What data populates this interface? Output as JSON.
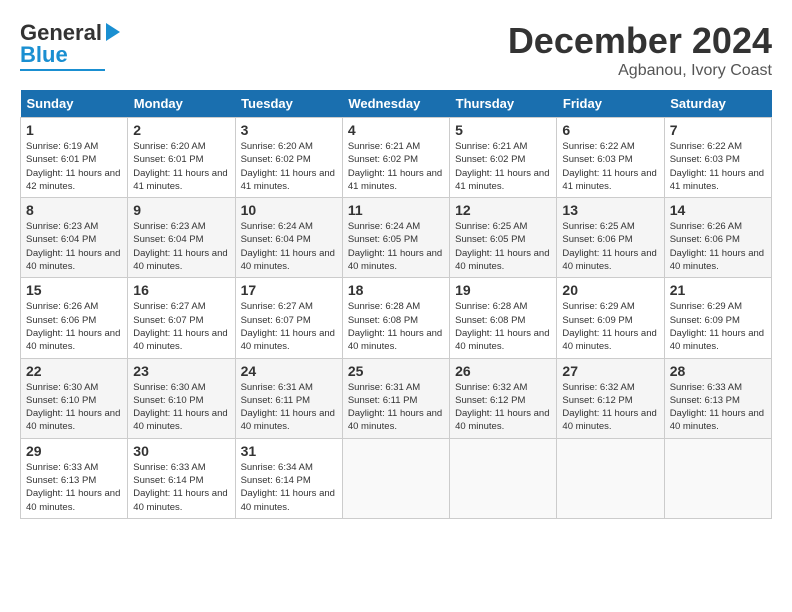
{
  "header": {
    "logo_line1": "General",
    "logo_line2": "Blue",
    "month": "December 2024",
    "location": "Agbanou, Ivory Coast"
  },
  "days_of_week": [
    "Sunday",
    "Monday",
    "Tuesday",
    "Wednesday",
    "Thursday",
    "Friday",
    "Saturday"
  ],
  "weeks": [
    [
      {
        "day": "1",
        "info": "Sunrise: 6:19 AM\nSunset: 6:01 PM\nDaylight: 11 hours and 42 minutes."
      },
      {
        "day": "2",
        "info": "Sunrise: 6:20 AM\nSunset: 6:01 PM\nDaylight: 11 hours and 41 minutes."
      },
      {
        "day": "3",
        "info": "Sunrise: 6:20 AM\nSunset: 6:02 PM\nDaylight: 11 hours and 41 minutes."
      },
      {
        "day": "4",
        "info": "Sunrise: 6:21 AM\nSunset: 6:02 PM\nDaylight: 11 hours and 41 minutes."
      },
      {
        "day": "5",
        "info": "Sunrise: 6:21 AM\nSunset: 6:02 PM\nDaylight: 11 hours and 41 minutes."
      },
      {
        "day": "6",
        "info": "Sunrise: 6:22 AM\nSunset: 6:03 PM\nDaylight: 11 hours and 41 minutes."
      },
      {
        "day": "7",
        "info": "Sunrise: 6:22 AM\nSunset: 6:03 PM\nDaylight: 11 hours and 41 minutes."
      }
    ],
    [
      {
        "day": "8",
        "info": "Sunrise: 6:23 AM\nSunset: 6:04 PM\nDaylight: 11 hours and 40 minutes."
      },
      {
        "day": "9",
        "info": "Sunrise: 6:23 AM\nSunset: 6:04 PM\nDaylight: 11 hours and 40 minutes."
      },
      {
        "day": "10",
        "info": "Sunrise: 6:24 AM\nSunset: 6:04 PM\nDaylight: 11 hours and 40 minutes."
      },
      {
        "day": "11",
        "info": "Sunrise: 6:24 AM\nSunset: 6:05 PM\nDaylight: 11 hours and 40 minutes."
      },
      {
        "day": "12",
        "info": "Sunrise: 6:25 AM\nSunset: 6:05 PM\nDaylight: 11 hours and 40 minutes."
      },
      {
        "day": "13",
        "info": "Sunrise: 6:25 AM\nSunset: 6:06 PM\nDaylight: 11 hours and 40 minutes."
      },
      {
        "day": "14",
        "info": "Sunrise: 6:26 AM\nSunset: 6:06 PM\nDaylight: 11 hours and 40 minutes."
      }
    ],
    [
      {
        "day": "15",
        "info": "Sunrise: 6:26 AM\nSunset: 6:06 PM\nDaylight: 11 hours and 40 minutes."
      },
      {
        "day": "16",
        "info": "Sunrise: 6:27 AM\nSunset: 6:07 PM\nDaylight: 11 hours and 40 minutes."
      },
      {
        "day": "17",
        "info": "Sunrise: 6:27 AM\nSunset: 6:07 PM\nDaylight: 11 hours and 40 minutes."
      },
      {
        "day": "18",
        "info": "Sunrise: 6:28 AM\nSunset: 6:08 PM\nDaylight: 11 hours and 40 minutes."
      },
      {
        "day": "19",
        "info": "Sunrise: 6:28 AM\nSunset: 6:08 PM\nDaylight: 11 hours and 40 minutes."
      },
      {
        "day": "20",
        "info": "Sunrise: 6:29 AM\nSunset: 6:09 PM\nDaylight: 11 hours and 40 minutes."
      },
      {
        "day": "21",
        "info": "Sunrise: 6:29 AM\nSunset: 6:09 PM\nDaylight: 11 hours and 40 minutes."
      }
    ],
    [
      {
        "day": "22",
        "info": "Sunrise: 6:30 AM\nSunset: 6:10 PM\nDaylight: 11 hours and 40 minutes."
      },
      {
        "day": "23",
        "info": "Sunrise: 6:30 AM\nSunset: 6:10 PM\nDaylight: 11 hours and 40 minutes."
      },
      {
        "day": "24",
        "info": "Sunrise: 6:31 AM\nSunset: 6:11 PM\nDaylight: 11 hours and 40 minutes."
      },
      {
        "day": "25",
        "info": "Sunrise: 6:31 AM\nSunset: 6:11 PM\nDaylight: 11 hours and 40 minutes."
      },
      {
        "day": "26",
        "info": "Sunrise: 6:32 AM\nSunset: 6:12 PM\nDaylight: 11 hours and 40 minutes."
      },
      {
        "day": "27",
        "info": "Sunrise: 6:32 AM\nSunset: 6:12 PM\nDaylight: 11 hours and 40 minutes."
      },
      {
        "day": "28",
        "info": "Sunrise: 6:33 AM\nSunset: 6:13 PM\nDaylight: 11 hours and 40 minutes."
      }
    ],
    [
      {
        "day": "29",
        "info": "Sunrise: 6:33 AM\nSunset: 6:13 PM\nDaylight: 11 hours and 40 minutes."
      },
      {
        "day": "30",
        "info": "Sunrise: 6:33 AM\nSunset: 6:14 PM\nDaylight: 11 hours and 40 minutes."
      },
      {
        "day": "31",
        "info": "Sunrise: 6:34 AM\nSunset: 6:14 PM\nDaylight: 11 hours and 40 minutes."
      },
      null,
      null,
      null,
      null
    ]
  ]
}
